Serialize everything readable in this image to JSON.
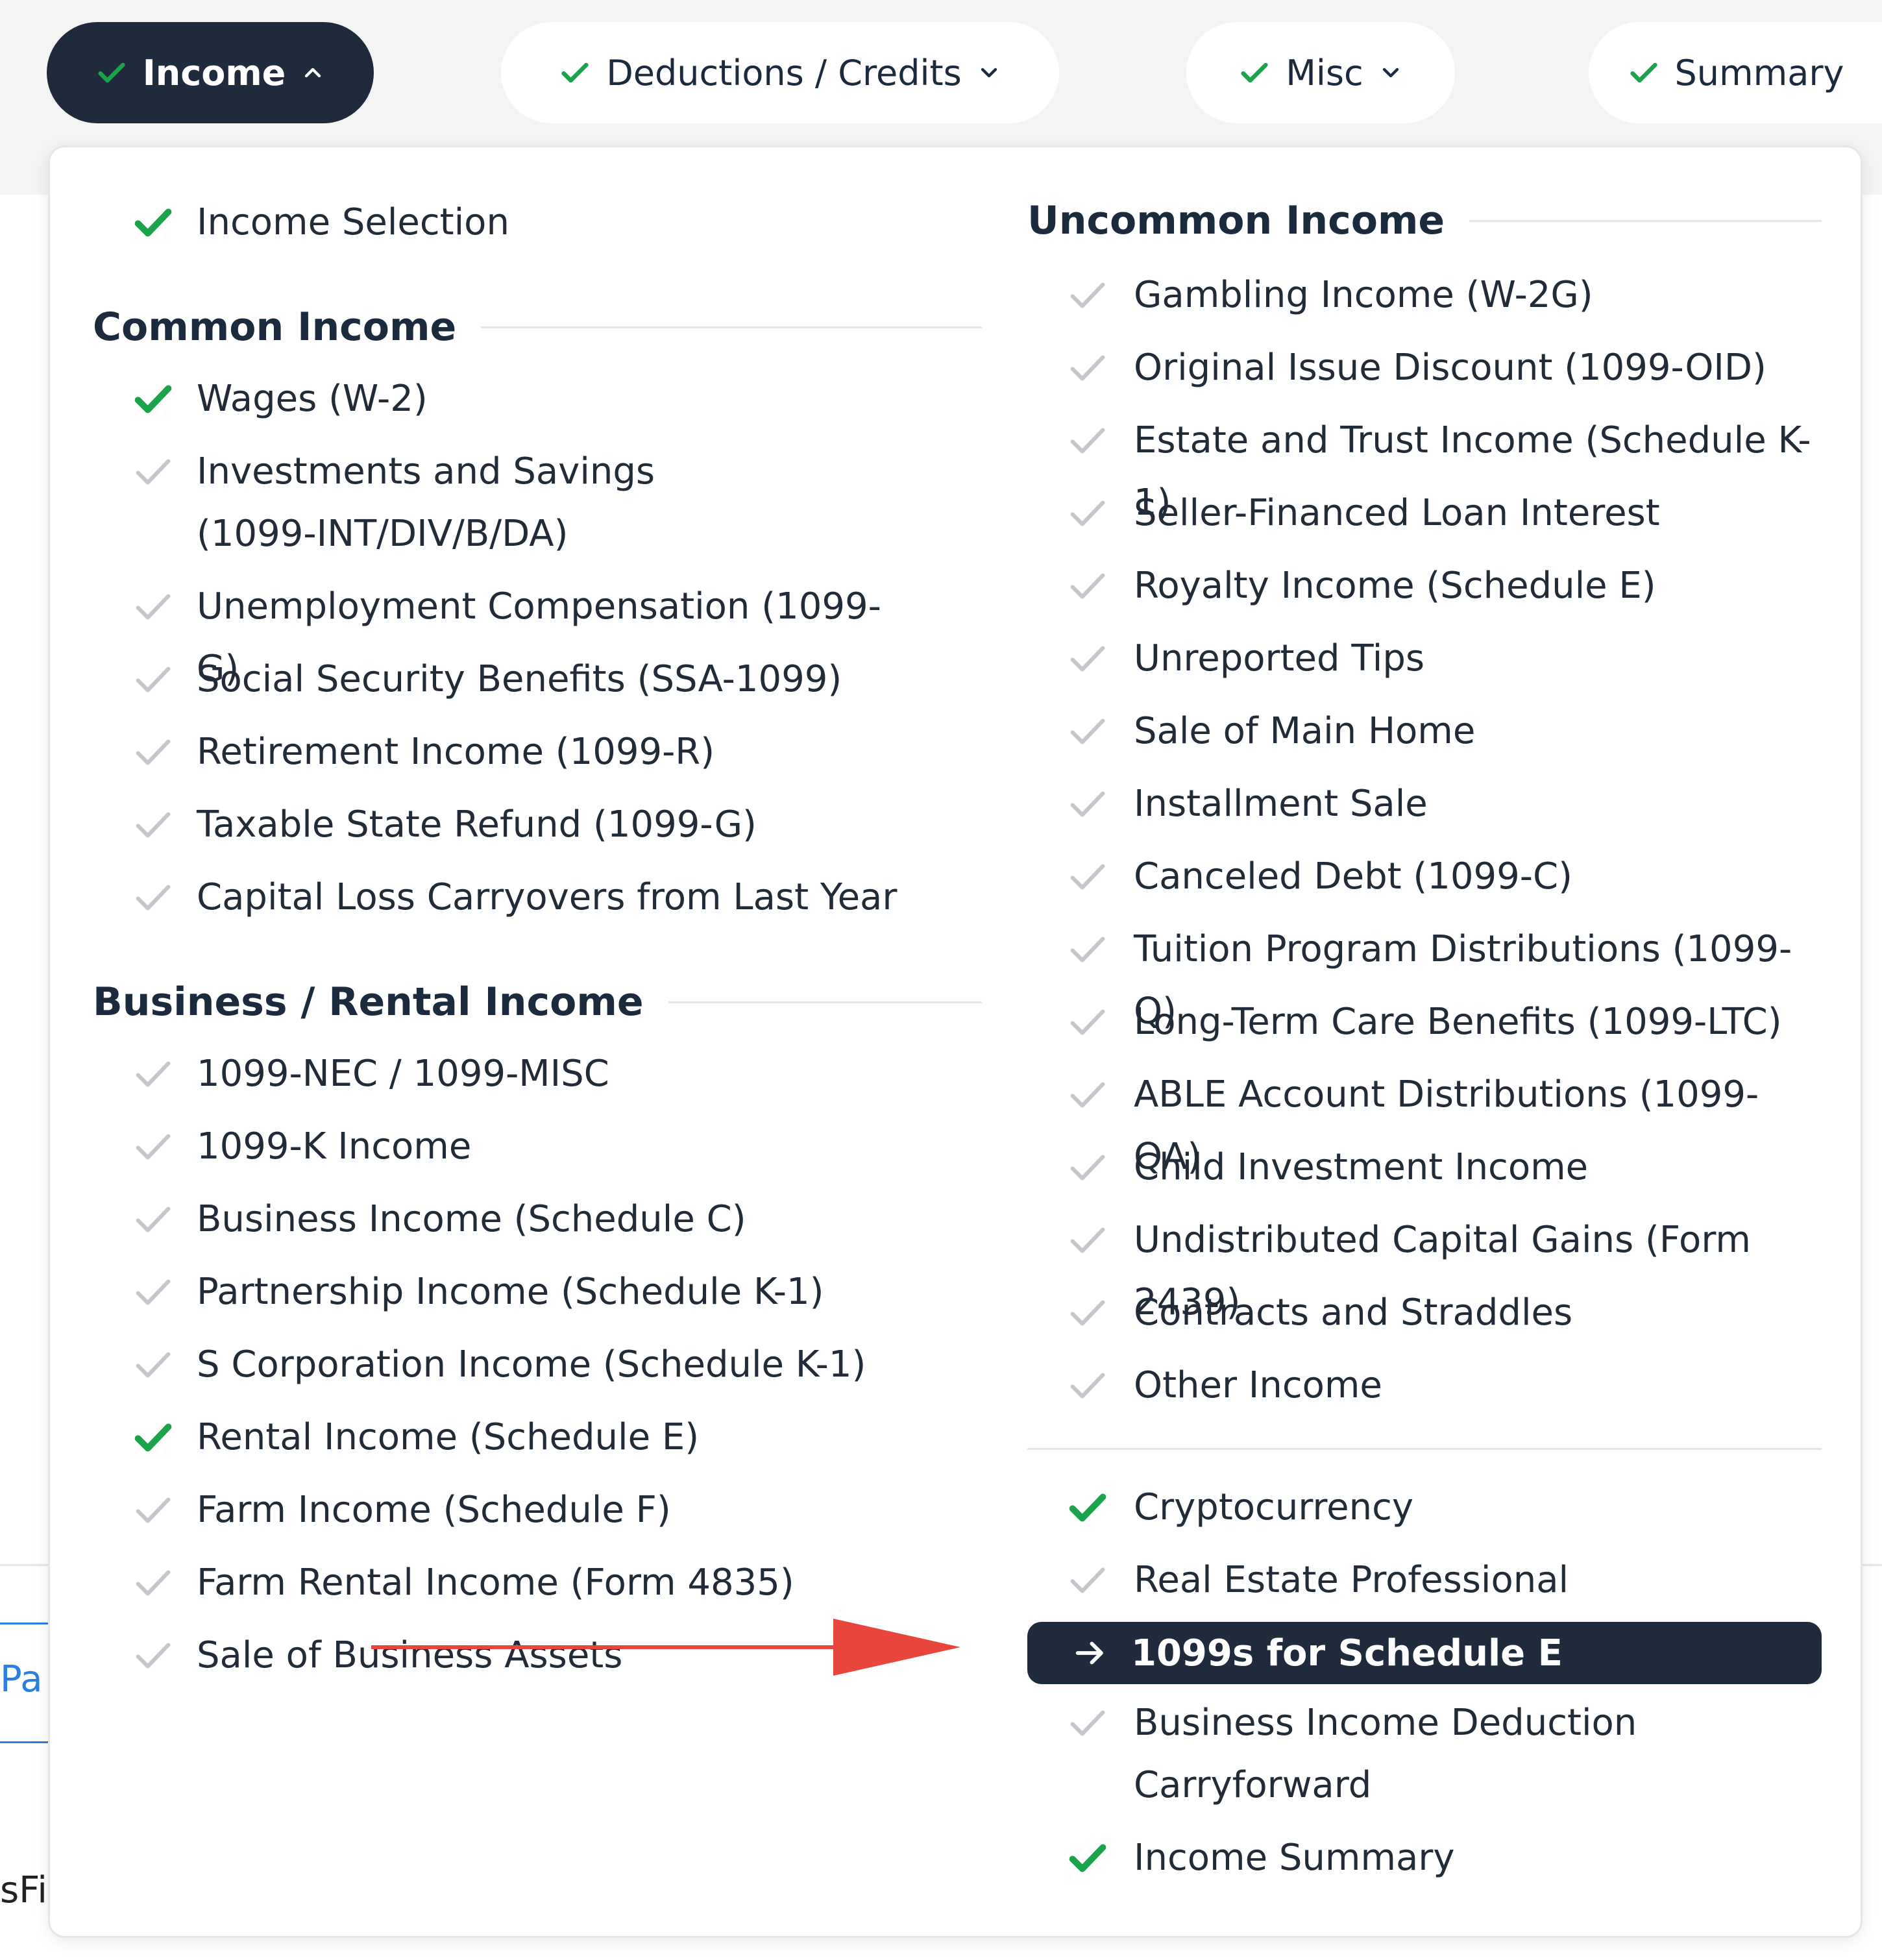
{
  "nav": {
    "tabs": [
      {
        "label": "Income",
        "state": "active"
      },
      {
        "label": "Deductions / Credits",
        "state": "inactive"
      },
      {
        "label": "Misc",
        "state": "inactive"
      },
      {
        "label": "Summary",
        "state": "inactive"
      }
    ]
  },
  "left_column": {
    "income_selection": "Income Selection",
    "common_income": {
      "heading": "Common Income",
      "items": [
        {
          "label": "Wages (W-2)",
          "status": "complete"
        },
        {
          "label": "Investments and Savings (1099-INT/DIV/B/DA)",
          "status": "pending"
        },
        {
          "label": "Unemployment Compensation (1099-G)",
          "status": "pending"
        },
        {
          "label": "Social Security Benefits (SSA-1099)",
          "status": "pending"
        },
        {
          "label": "Retirement Income (1099-R)",
          "status": "pending"
        },
        {
          "label": "Taxable State Refund (1099-G)",
          "status": "pending"
        },
        {
          "label": "Capital Loss Carryovers from Last Year",
          "status": "pending"
        }
      ]
    },
    "business_rental_income": {
      "heading": "Business / Rental Income",
      "items": [
        {
          "label": "1099-NEC / 1099-MISC",
          "status": "pending"
        },
        {
          "label": "1099-K Income",
          "status": "pending"
        },
        {
          "label": "Business Income (Schedule C)",
          "status": "pending"
        },
        {
          "label": "Partnership Income (Schedule K-1)",
          "status": "pending"
        },
        {
          "label": "S Corporation Income (Schedule K-1)",
          "status": "pending"
        },
        {
          "label": "Rental Income (Schedule E)",
          "status": "complete"
        },
        {
          "label": "Farm Income (Schedule F)",
          "status": "pending"
        },
        {
          "label": "Farm Rental Income (Form 4835)",
          "status": "pending"
        },
        {
          "label": "Sale of Business Assets",
          "status": "pending"
        }
      ]
    }
  },
  "right_column": {
    "uncommon_income": {
      "heading": "Uncommon Income",
      "items": [
        {
          "label": "Gambling Income (W-2G)",
          "status": "pending"
        },
        {
          "label": "Original Issue Discount (1099-OID)",
          "status": "pending"
        },
        {
          "label": "Estate and Trust Income (Schedule K-1)",
          "status": "pending"
        },
        {
          "label": "Seller-Financed Loan Interest",
          "status": "pending"
        },
        {
          "label": "Royalty Income (Schedule E)",
          "status": "pending"
        },
        {
          "label": "Unreported Tips",
          "status": "pending"
        },
        {
          "label": "Sale of Main Home",
          "status": "pending"
        },
        {
          "label": "Installment Sale",
          "status": "pending"
        },
        {
          "label": "Canceled Debt (1099-C)",
          "status": "pending"
        },
        {
          "label": "Tuition Program Distributions (1099-Q)",
          "status": "pending"
        },
        {
          "label": "Long-Term Care Benefits (1099-LTC)",
          "status": "pending"
        },
        {
          "label": "ABLE Account Distributions (1099-QA)",
          "status": "pending"
        },
        {
          "label": "Child Investment Income",
          "status": "pending"
        },
        {
          "label": "Undistributed Capital Gains (Form 2439)",
          "status": "pending"
        },
        {
          "label": "Contracts and Straddles",
          "status": "pending"
        },
        {
          "label": "Other Income",
          "status": "pending"
        }
      ]
    },
    "extra_items": [
      {
        "label": "Cryptocurrency",
        "status": "complete"
      },
      {
        "label": "Real Estate Professional",
        "status": "pending"
      },
      {
        "label": "1099s for Schedule E",
        "status": "current"
      },
      {
        "label": "Business Income Deduction Carryforward",
        "status": "pending"
      },
      {
        "label": "Income Summary",
        "status": "complete"
      }
    ]
  },
  "background": {
    "link_fragment": "Pa",
    "text_fragment": "sFi"
  },
  "colors": {
    "nav_active_bg": "#1f2b3d",
    "check_complete": "#1aa34a",
    "check_pending": "#c4c7cc",
    "annotation_arrow": "#e8453c",
    "link_blue": "#2b7fe0"
  },
  "icons": {
    "complete": "check-icon",
    "pending": "faded-check-icon",
    "current": "arrow-right-icon",
    "tab_open": "chevron-up-icon",
    "tab_closed": "chevron-down-icon"
  }
}
